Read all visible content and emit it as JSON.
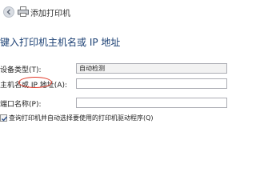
{
  "window": {
    "title": "添加打印机"
  },
  "heading": "键入打印机主机名或 IP 地址",
  "form": {
    "device_type": {
      "label": "设备类型(T):",
      "value": "自动检测"
    },
    "hostname": {
      "label": "主机名或 IP 地址(A):",
      "value": ""
    },
    "port_name": {
      "label": "端口名称(P):",
      "value": ""
    },
    "query_driver": {
      "label": "查询打印机并自动选择要使用的打印机驱动程序(Q)",
      "checked": true
    }
  },
  "colors": {
    "heading": "#1a3f73",
    "highlight_ring": "#e23a2a",
    "field_border": "#abadb3"
  },
  "icons": {
    "back": "back-arrow-icon",
    "printer": "printer-icon",
    "check": "checkmark-icon"
  }
}
